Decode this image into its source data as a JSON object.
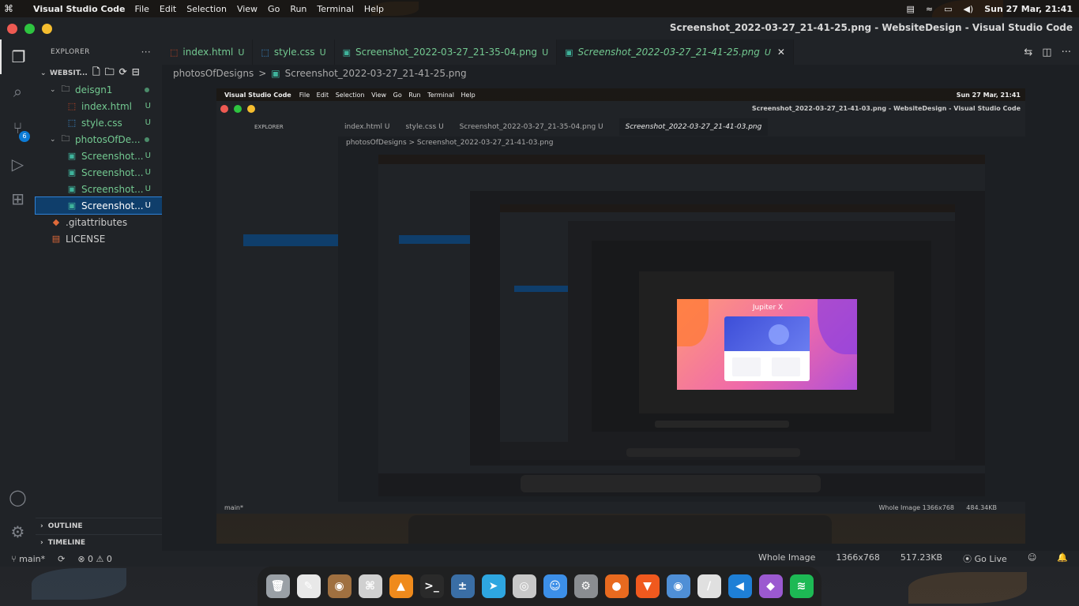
{
  "topbar": {
    "logo": "⌘",
    "app_name": "Visual Studio Code",
    "menus": [
      "File",
      "Edit",
      "Selection",
      "View",
      "Go",
      "Run",
      "Terminal",
      "Help"
    ],
    "clock": "Sun 27 Mar, 21:41"
  },
  "window": {
    "title": "Screenshot_2022-03-27_21-41-25.png - WebsiteDesign - Visual Studio Code"
  },
  "activity": {
    "scm_badge": "6"
  },
  "sidebar": {
    "header": "EXPLORER",
    "more": "···",
    "root": "WEBSIT...",
    "items": [
      {
        "label": "deisgn1",
        "kind": "folder",
        "depth": 1,
        "status": "dot"
      },
      {
        "label": "index.html",
        "kind": "html",
        "depth": 2,
        "status": "U"
      },
      {
        "label": "style.css",
        "kind": "css",
        "depth": 2,
        "status": "U"
      },
      {
        "label": "photosOfDe...",
        "kind": "folder",
        "depth": 1,
        "status": "dot"
      },
      {
        "label": "Screenshot...",
        "kind": "image",
        "depth": 2,
        "status": "U"
      },
      {
        "label": "Screenshot...",
        "kind": "image",
        "depth": 2,
        "status": "U"
      },
      {
        "label": "Screenshot...",
        "kind": "image",
        "depth": 2,
        "status": "U"
      },
      {
        "label": "Screenshot...",
        "kind": "image",
        "depth": 2,
        "status": "U",
        "selected": true
      },
      {
        "label": ".gitattributes",
        "kind": "git",
        "depth": 1,
        "status": ""
      },
      {
        "label": "LICENSE",
        "kind": "license",
        "depth": 1,
        "status": ""
      }
    ],
    "outline": "OUTLINE",
    "timeline": "TIMELINE"
  },
  "tabs": [
    {
      "label": "index.html",
      "status": "U",
      "kind": "html"
    },
    {
      "label": "style.css",
      "status": "U",
      "kind": "css"
    },
    {
      "label": "Screenshot_2022-03-27_21-35-04.png",
      "status": "U",
      "kind": "image"
    },
    {
      "label": "Screenshot_2022-03-27_21-41-25.png",
      "status": "U",
      "kind": "image",
      "active": true
    }
  ],
  "breadcrumb": {
    "folder": "photosOfDesigns",
    "separator": ">",
    "file": "Screenshot_2022-03-27_21-41-25.png"
  },
  "statusbar": {
    "branch": "main*",
    "sync": "⟳",
    "problems": "⊗ 0 ⚠ 0",
    "zoom": "Whole Image",
    "dimensions": "1366x768",
    "filesize": "517.23KB",
    "golive": "Go Live"
  },
  "nested": {
    "clock": "Sun 27 Mar, 21:41",
    "title": "Screenshot_2022-03-27_21-41-03.png - WebsiteDesign - Visual Studio Code",
    "tab_active": "Screenshot_2022-03-27_21-41-03.png",
    "breadcrumb": "photosOfDesigns > Screenshot_2022-03-27_21-41-03.png",
    "filesize": "484.34KB",
    "hero_title": "Jupiter X"
  },
  "dock": {
    "apps": [
      {
        "name": "trash",
        "color": "#9aa0a6",
        "glyph": "🗑"
      },
      {
        "name": "screenshot",
        "color": "#e8e8e8",
        "glyph": "✎"
      },
      {
        "name": "gimp",
        "color": "#a07040",
        "glyph": "◉"
      },
      {
        "name": "keyboard",
        "color": "#d0d0d0",
        "glyph": "⌘"
      },
      {
        "name": "vlc",
        "color": "#ef8a1c",
        "glyph": "▲"
      },
      {
        "name": "terminal",
        "color": "#2a2a2a",
        "glyph": ">_"
      },
      {
        "name": "calculator",
        "color": "#3a6ea5",
        "glyph": "±"
      },
      {
        "name": "telegram",
        "color": "#2ea6e0",
        "glyph": "➤"
      },
      {
        "name": "camera",
        "color": "#c8c8c8",
        "glyph": "◎"
      },
      {
        "name": "finder",
        "color": "#3c8fe8",
        "glyph": "☺"
      },
      {
        "name": "settings",
        "color": "#8a8d91",
        "glyph": "⚙"
      },
      {
        "name": "firefox",
        "color": "#e86a1f",
        "glyph": "●"
      },
      {
        "name": "brave",
        "color": "#f0591e",
        "glyph": "▼"
      },
      {
        "name": "cheese",
        "color": "#4f8fd6",
        "glyph": "◉"
      },
      {
        "name": "editor",
        "color": "#e0e0e0",
        "glyph": "/"
      },
      {
        "name": "vscode",
        "color": "#1e7fd6",
        "glyph": "◀"
      },
      {
        "name": "github",
        "color": "#9b59d0",
        "glyph": "◆"
      },
      {
        "name": "spotify",
        "color": "#1db954",
        "glyph": "≋"
      }
    ]
  }
}
